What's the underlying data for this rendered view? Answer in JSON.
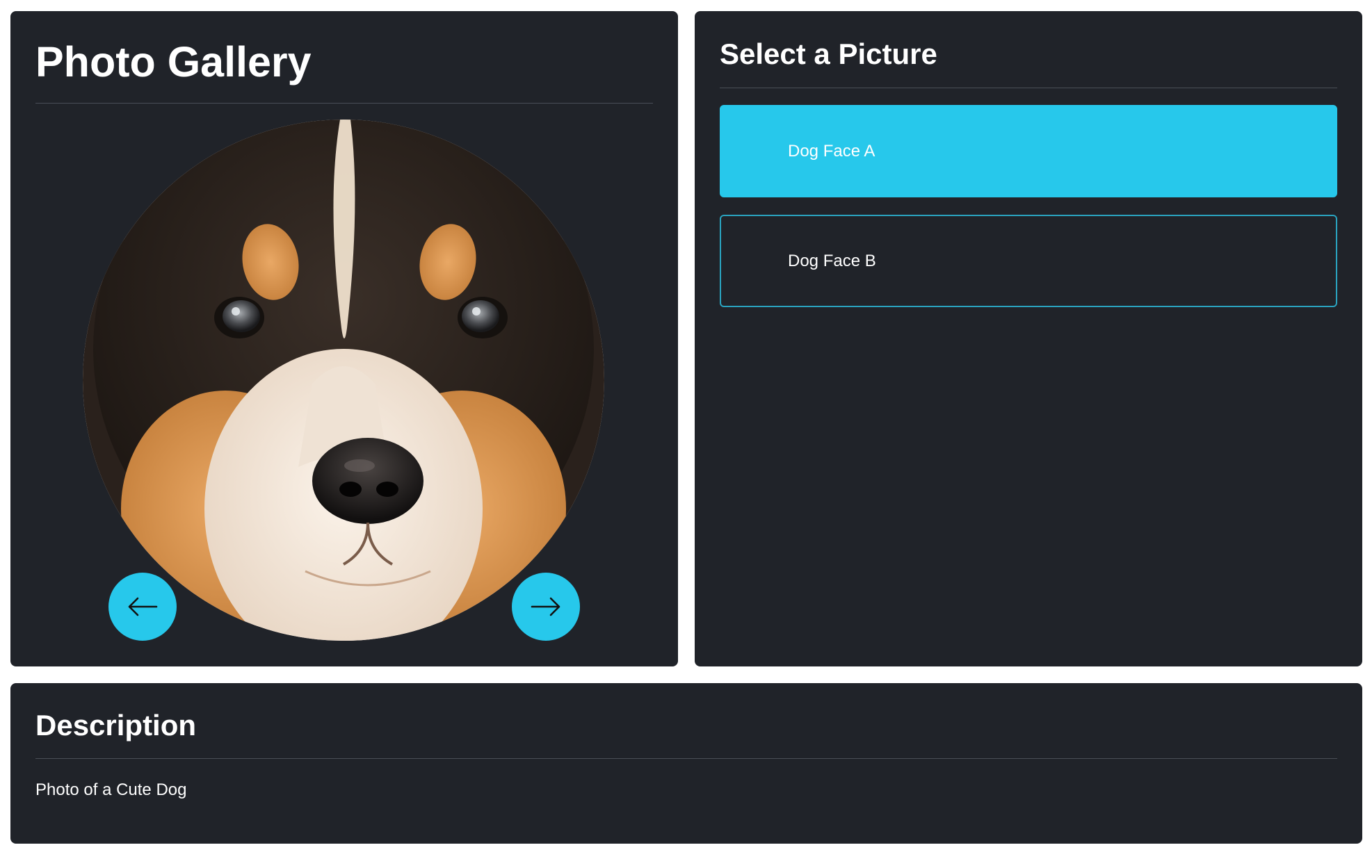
{
  "gallery": {
    "title": "Photo Gallery",
    "photo_icon": "dog-photo",
    "prev_icon": "arrow-left-icon",
    "next_icon": "arrow-right-icon"
  },
  "select": {
    "title": "Select a Picture",
    "options": [
      {
        "label": "Dog Face A",
        "selected": true
      },
      {
        "label": "Dog Face B",
        "selected": false
      }
    ]
  },
  "description": {
    "title": "Description",
    "text": "Photo of a Cute Dog"
  },
  "colors": {
    "card_bg": "#202329",
    "accent": "#27c8eb",
    "page_bg": "#ffffff"
  }
}
